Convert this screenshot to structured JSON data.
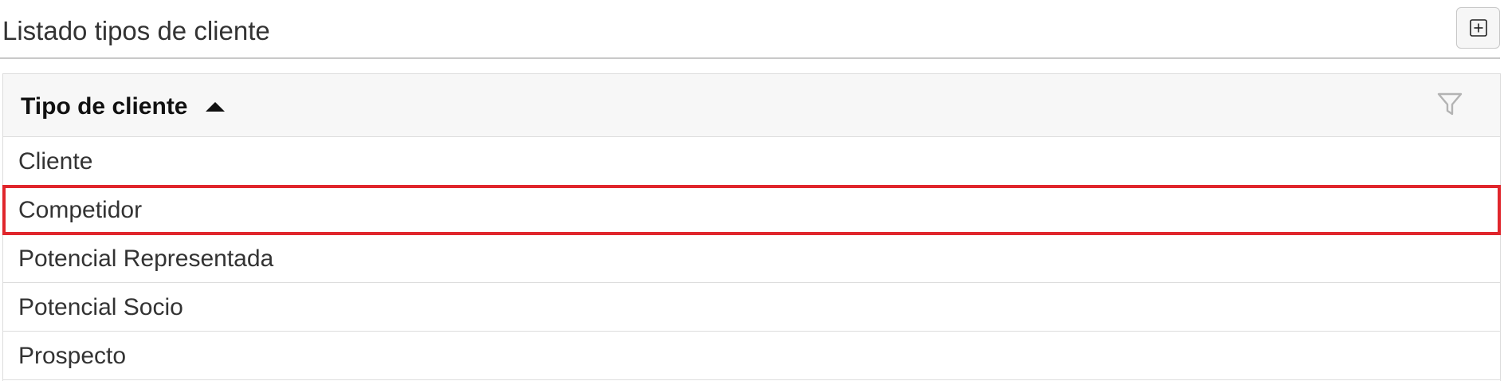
{
  "header": {
    "title": "Listado tipos de cliente",
    "add_button_icon": "plus-square-icon"
  },
  "grid": {
    "column": {
      "label": "Tipo de cliente",
      "sort": "ascending",
      "sort_icon": "caret-up-icon",
      "filter_icon": "filter-icon"
    },
    "rows": [
      {
        "label": "Cliente",
        "selected": false
      },
      {
        "label": "Competidor",
        "selected": true
      },
      {
        "label": "Potencial Representada",
        "selected": false
      },
      {
        "label": "Potencial Socio",
        "selected": false
      },
      {
        "label": "Prospecto",
        "selected": false
      }
    ]
  },
  "colors": {
    "selection_outline": "#e0262c",
    "header_background": "#f7f7f7",
    "border": "#dddddd",
    "text": "#333333"
  }
}
